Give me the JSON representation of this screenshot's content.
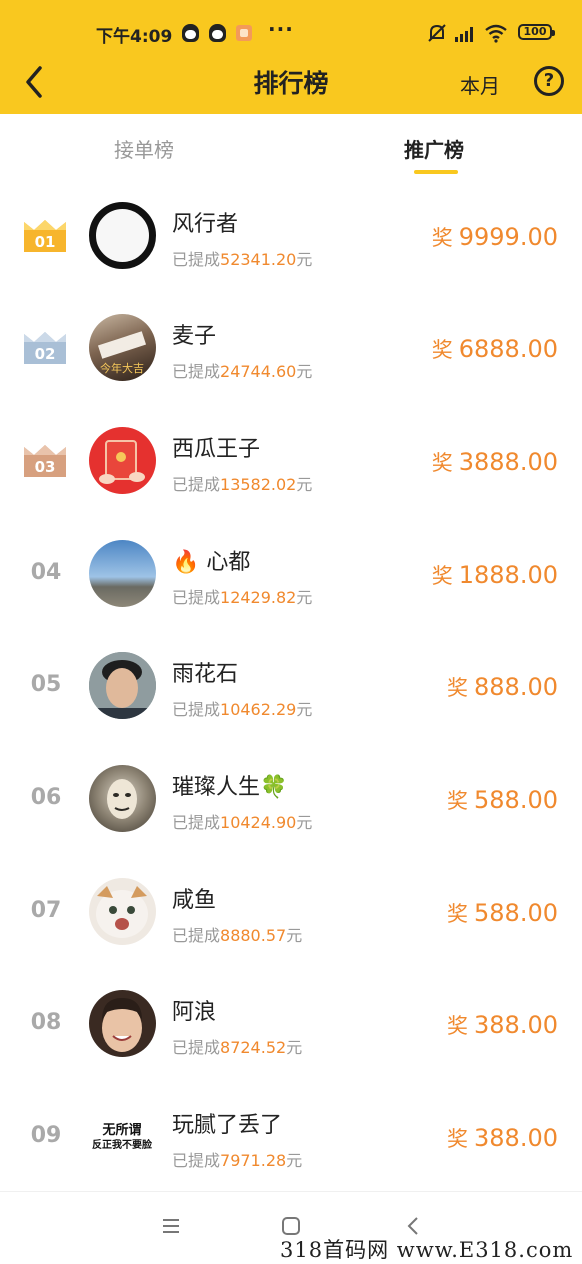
{
  "status_bar": {
    "time": "下午4:09",
    "more": "···",
    "battery": "100"
  },
  "header": {
    "title": "排行榜",
    "month_filter": "本月",
    "help": "?"
  },
  "tabs": [
    {
      "label": "接单榜",
      "active": false
    },
    {
      "label": "推广榜",
      "active": true
    }
  ],
  "withdraw_prefix": "已提成",
  "withdraw_suffix": "元",
  "reward_prefix": "奖",
  "ranks": [
    {
      "rank": "01",
      "name": "风行者",
      "withdrawn": "52341.20",
      "reward": "9999.00",
      "medal": "gold"
    },
    {
      "rank": "02",
      "name": "麦子",
      "withdrawn": "24744.60",
      "reward": "6888.00",
      "medal": "silver"
    },
    {
      "rank": "03",
      "name": "西瓜王子",
      "withdrawn": "13582.02",
      "reward": "3888.00",
      "medal": "bronze"
    },
    {
      "rank": "04",
      "name": "🔥 心都",
      "withdrawn": "12429.82",
      "reward": "1888.00"
    },
    {
      "rank": "05",
      "name": "雨花石",
      "withdrawn": "10462.29",
      "reward": "888.00"
    },
    {
      "rank": "06",
      "name": "璀璨人生🍀",
      "withdrawn": "10424.90",
      "reward": "588.00"
    },
    {
      "rank": "07",
      "name": "咸鱼",
      "withdrawn": "8880.57",
      "reward": "588.00"
    },
    {
      "rank": "08",
      "name": "阿浪",
      "withdrawn": "8724.52",
      "reward": "388.00"
    },
    {
      "rank": "09",
      "name": "玩腻了丢了",
      "withdrawn": "7971.28",
      "reward": "388.00"
    }
  ],
  "avatar_texts": {
    "row2": "今年大吉",
    "row9_line1": "无所谓",
    "row9_line2": "反正我不要脸"
  },
  "colors": {
    "header_bg": "#f9c81f",
    "accent_orange": "#f0892e",
    "gold": "#f7b52c",
    "silver": "#a9bfd6",
    "bronze": "#d7a07f"
  },
  "watermark": "318首码网 www.E318.com"
}
